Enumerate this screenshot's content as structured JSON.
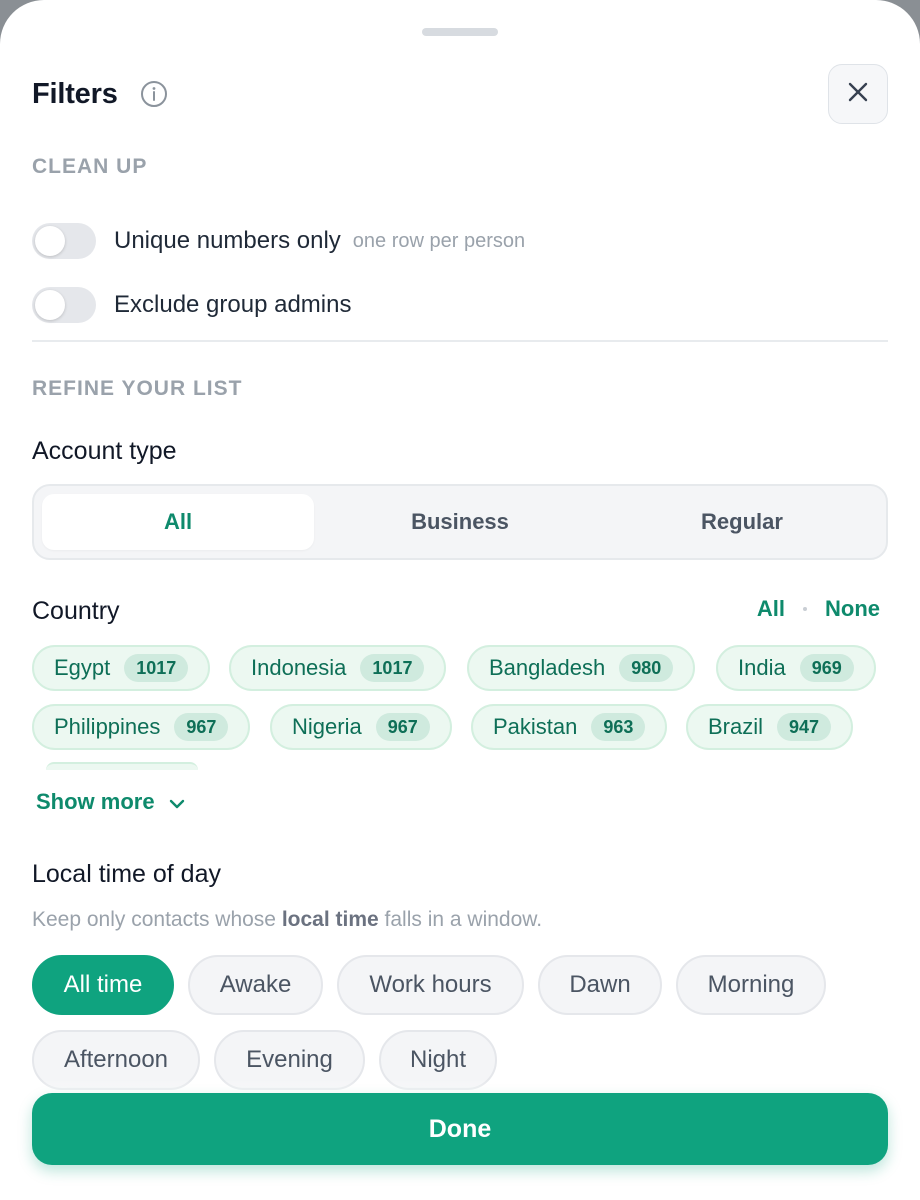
{
  "header": {
    "title": "Filters",
    "info_icon": "info-icon",
    "close_icon": "close-icon"
  },
  "clean_up": {
    "label": "CLEAN UP",
    "toggles": [
      {
        "label": "Unique numbers only",
        "hint": "one row per person",
        "on": false
      },
      {
        "label": "Exclude group admins",
        "hint": "",
        "on": false
      }
    ]
  },
  "refine": {
    "label": "REFINE YOUR LIST",
    "account_type": {
      "label": "Account type",
      "options": [
        "All",
        "Business",
        "Regular"
      ],
      "selected": "All"
    },
    "country": {
      "label": "Country",
      "select_all": "All",
      "select_none": "None",
      "items": [
        {
          "name": "Egypt",
          "count": "1017"
        },
        {
          "name": "Indonesia",
          "count": "1017"
        },
        {
          "name": "Bangladesh",
          "count": "980"
        },
        {
          "name": "India",
          "count": "969"
        },
        {
          "name": "Philippines",
          "count": "967"
        },
        {
          "name": "Nigeria",
          "count": "967"
        },
        {
          "name": "Pakistan",
          "count": "963"
        },
        {
          "name": "Brazil",
          "count": "947"
        }
      ],
      "show_more": "Show more"
    },
    "time_of_day": {
      "label": "Local time of day",
      "desc_pre": "Keep only contacts whose ",
      "desc_bold": "local time",
      "desc_post": " falls in a window.",
      "options": [
        "All time",
        "Awake",
        "Work hours",
        "Dawn",
        "Morning",
        "Afternoon",
        "Evening",
        "Night"
      ],
      "selected": "All time"
    }
  },
  "footer": {
    "done_label": "Done"
  },
  "colors": {
    "accent": "#0fa37f",
    "accent_text": "#0e8a6c",
    "chip_bg": "#ecf8f1"
  }
}
